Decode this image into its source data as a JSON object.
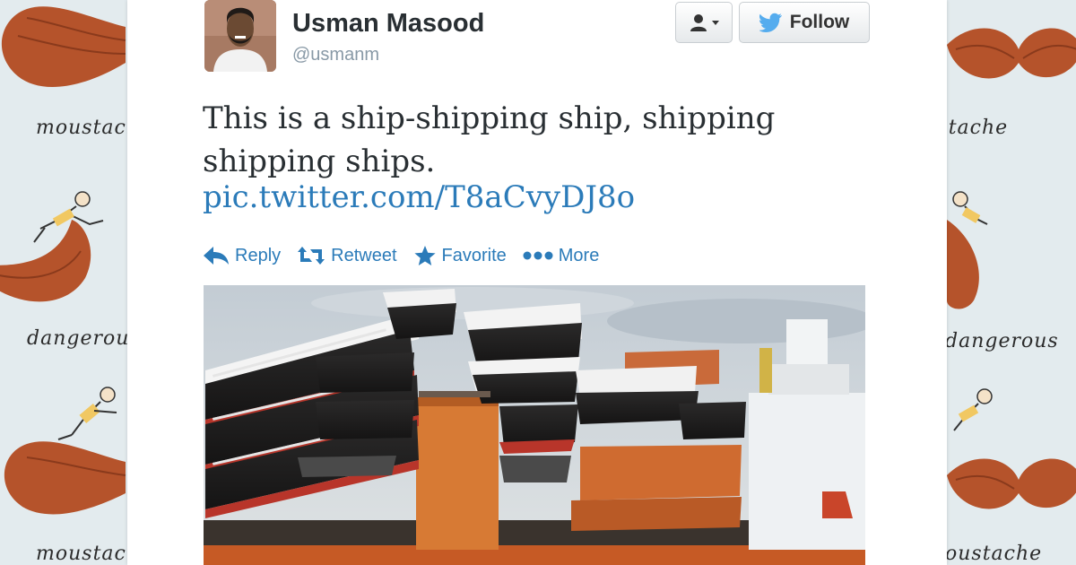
{
  "wallpaper": {
    "word_1": "moustache",
    "word_2": "dangerous"
  },
  "tweet": {
    "author_name": "Usman Masood",
    "author_handle": "@usmanm",
    "follow_label": "Follow",
    "text": "This is a ship-shipping ship, shipping shipping ships.",
    "link": "pic.twitter.com/T8aCvyDJ8o"
  },
  "actions": [
    {
      "label": "Reply",
      "icon": "reply-icon"
    },
    {
      "label": "Retweet",
      "icon": "retweet-icon"
    },
    {
      "label": "Favorite",
      "icon": "star-icon"
    },
    {
      "label": "More",
      "icon": "more-dots-icon"
    }
  ],
  "colors": {
    "link": "#2b7bb9",
    "text": "#292f33",
    "handle": "#8899a6",
    "twitter_bird": "#55acee",
    "moustache": "#b5532b"
  }
}
